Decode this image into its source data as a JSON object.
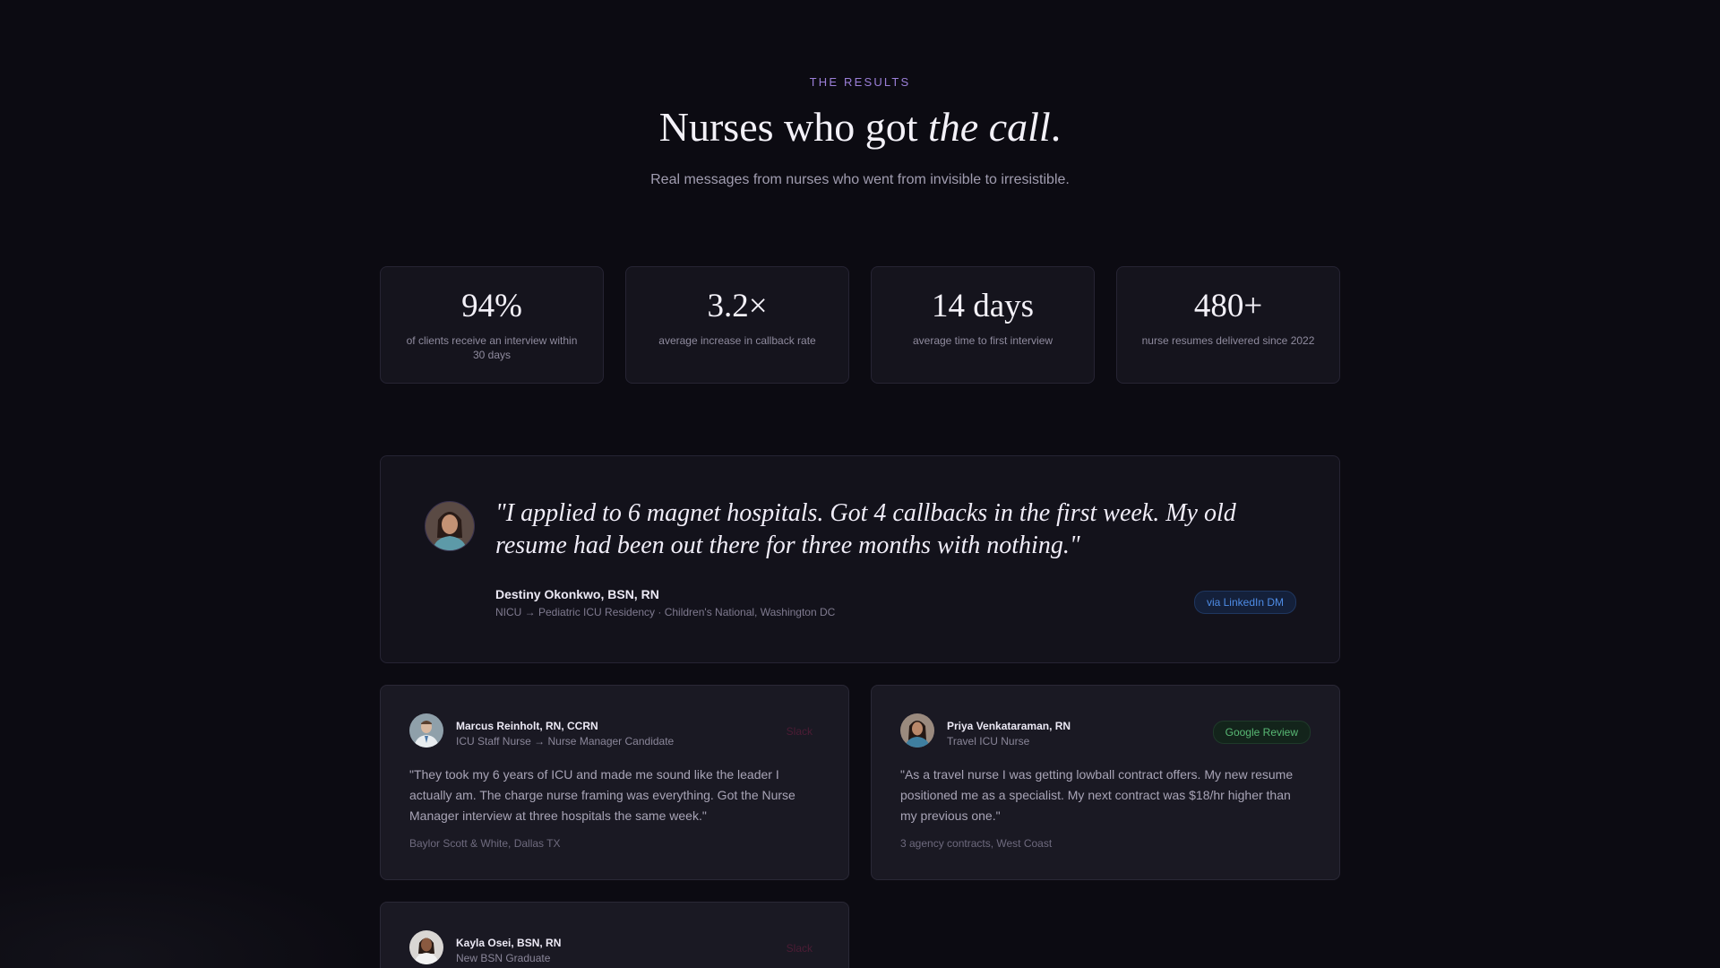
{
  "header": {
    "eyebrow": "THE RESULTS",
    "title_main": "Nurses who got ",
    "title_emphasis": "the call",
    "title_end": ".",
    "subtitle": "Real messages from nurses who went from invisible to irresistible."
  },
  "stats": [
    {
      "value": "94%",
      "label": "of clients receive an interview within 30 days"
    },
    {
      "value": "3.2×",
      "label": "average increase in callback rate"
    },
    {
      "value": "14 days",
      "label": "average time to first interview"
    },
    {
      "value": "480+",
      "label": "nurse resumes delivered since 2022"
    }
  ],
  "featured": {
    "quote": "\"I applied to 6 magnet hospitals. Got 4 callbacks in the first week. My old resume had been out there for three months with nothing.\"",
    "name": "Destiny Okonkwo, BSN, RN",
    "meta": "NICU → Pediatric ICU Residency · Children's National, Washington DC",
    "source": "via LinkedIn DM"
  },
  "cards": [
    {
      "name": "Marcus Reinholt, RN, CCRN",
      "role": "ICU Staff Nurse → Nurse Manager Candidate",
      "source": "Slack",
      "quote": "\"They took my 6 years of ICU and made me sound like the leader I actually am. The charge nurse framing was everything. Got the Nurse Manager interview at three hospitals the same week.\"",
      "location": "Baylor Scott & White, Dallas TX"
    },
    {
      "name": "Priya Venkataraman, RN",
      "role": "Travel ICU Nurse",
      "source": "Google Review",
      "quote": "\"As a travel nurse I was getting lowball contract offers. My new resume positioned me as a specialist. My next contract was $18/hr higher than my previous one.\"",
      "location": "3 agency contracts, West Coast"
    },
    {
      "name": "Kayla Osei, BSN, RN",
      "role": "New BSN Graduate",
      "source": "Slack"
    }
  ]
}
